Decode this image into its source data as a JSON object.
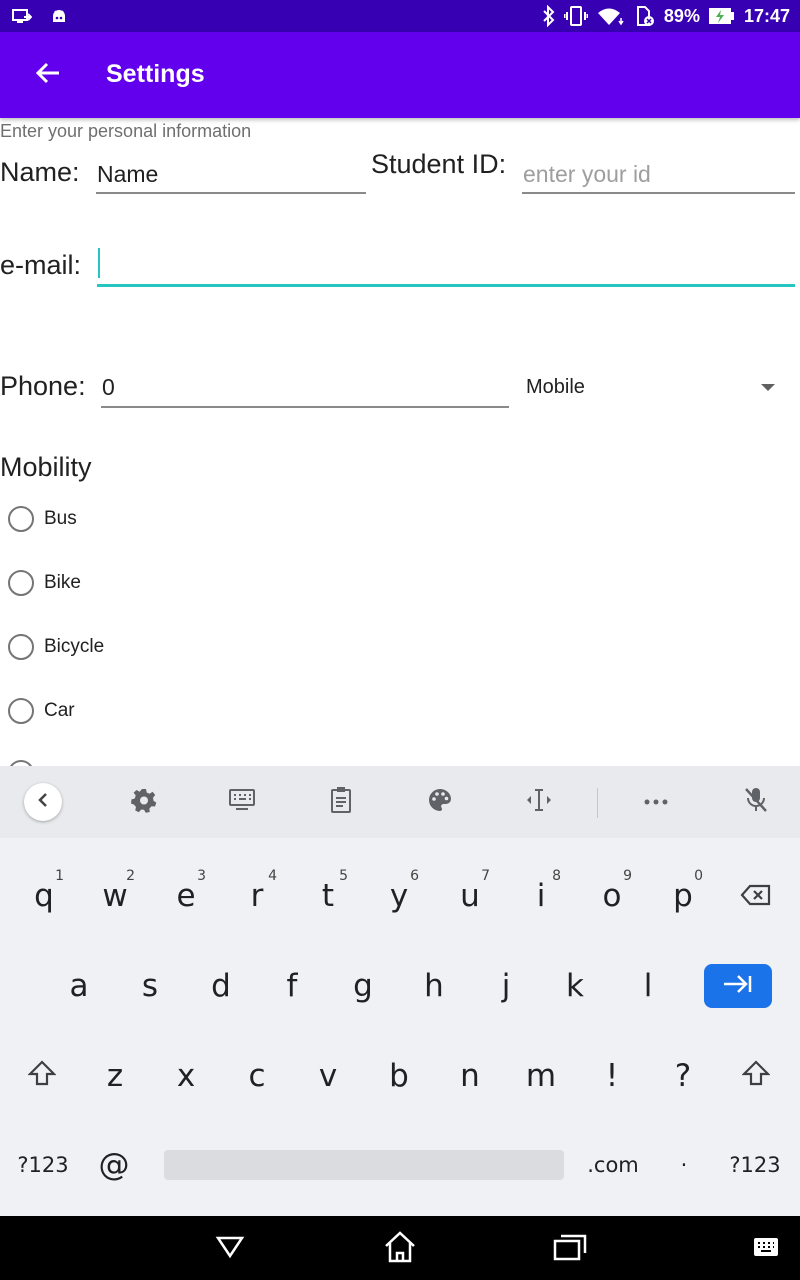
{
  "status_bar": {
    "left_icons": [
      "screen-share-icon",
      "android-debug-icon"
    ],
    "right_icons": [
      "bluetooth-icon",
      "vibrate-icon",
      "wifi-icon",
      "no-sim-icon"
    ],
    "battery_percent": "89%",
    "time": "17:47"
  },
  "app_bar": {
    "title": "Settings",
    "back_icon": "arrow-left-icon",
    "background": "#6200ee"
  },
  "form": {
    "hint": "Enter your personal information",
    "name_label": "Name:",
    "name_value": "Name",
    "student_id_label": "Student ID:",
    "student_id_placeholder": "enter your id",
    "email_label": "e-mail:",
    "email_value": "",
    "phone_label": "Phone:",
    "phone_value": "0",
    "phone_type": "Mobile",
    "mobility_title": "Mobility",
    "mobility_options": [
      "Bus",
      "Bike",
      "Bicycle",
      "Car"
    ],
    "accent": "#26c6c0"
  },
  "keyboard": {
    "toolbar_icons": [
      "chevron-left-icon",
      "gear-icon",
      "keyboard-icon",
      "clipboard-icon",
      "palette-icon",
      "text-cursor-icon",
      "more-icon",
      "mic-off-icon"
    ],
    "row1": [
      {
        "k": "q",
        "h": "1"
      },
      {
        "k": "w",
        "h": "2"
      },
      {
        "k": "e",
        "h": "3"
      },
      {
        "k": "r",
        "h": "4"
      },
      {
        "k": "t",
        "h": "5"
      },
      {
        "k": "y",
        "h": "6"
      },
      {
        "k": "u",
        "h": "7"
      },
      {
        "k": "i",
        "h": "8"
      },
      {
        "k": "o",
        "h": "9"
      },
      {
        "k": "p",
        "h": "0"
      }
    ],
    "row2": [
      "a",
      "s",
      "d",
      "f",
      "g",
      "h",
      "j",
      "k",
      "l"
    ],
    "row3": [
      "z",
      "x",
      "c",
      "v",
      "b",
      "n",
      "m",
      "!",
      "?"
    ],
    "row4": {
      "sym_left": "?123",
      "at": "@",
      "dotcom": ".com",
      "dot": "·",
      "sym_right": "?123"
    },
    "enter_color": "#1a73e8"
  },
  "nav_bar": {
    "icons": [
      "back-triangle-icon",
      "home-icon",
      "recents-icon",
      "keyboard-switch-icon"
    ]
  }
}
